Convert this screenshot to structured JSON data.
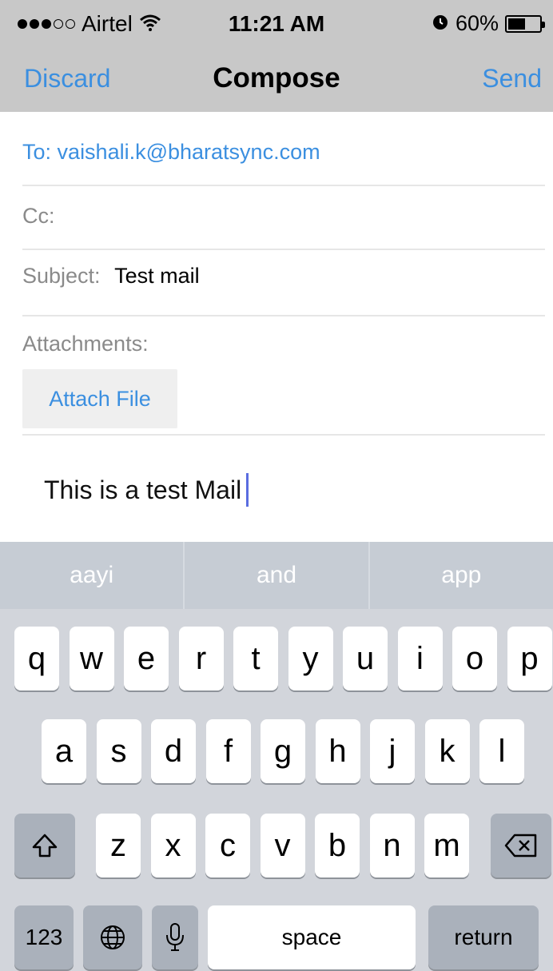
{
  "status_bar": {
    "carrier": "Airtel",
    "time": "11:21 AM",
    "battery": "60%",
    "battery_level": 0.6
  },
  "nav": {
    "discard": "Discard",
    "title": "Compose",
    "send": "Send"
  },
  "form": {
    "to_label": "To:",
    "to_value": "vaishali.k@bharatsync.com",
    "cc_label": "Cc:",
    "subject_label": "Subject:",
    "subject_value": "Test mail",
    "attachments_label": "Attachments:",
    "attach_button": "Attach File",
    "body": "This is a test Mail"
  },
  "keyboard": {
    "suggestions": [
      "aayi",
      "and",
      "app"
    ],
    "row1": [
      "q",
      "w",
      "e",
      "r",
      "t",
      "y",
      "u",
      "i",
      "o",
      "p"
    ],
    "row2": [
      "a",
      "s",
      "d",
      "f",
      "g",
      "h",
      "j",
      "k",
      "l"
    ],
    "row3": [
      "z",
      "x",
      "c",
      "v",
      "b",
      "n",
      "m"
    ],
    "numbers_key": "123",
    "space_key": "space",
    "return_key": "return",
    "icons": [
      "shift-icon",
      "backspace-icon",
      "globe-icon",
      "microphone-icon"
    ]
  }
}
